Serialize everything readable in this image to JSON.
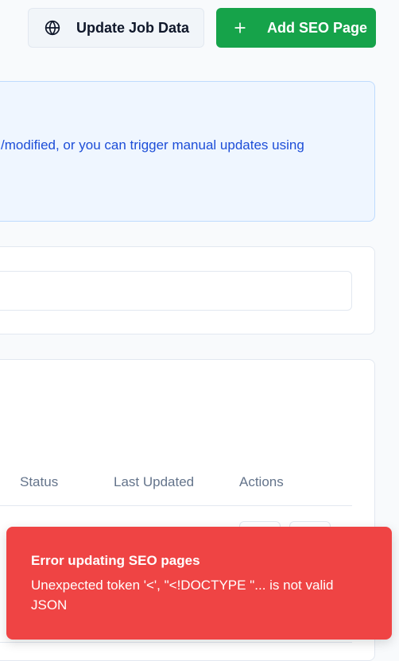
{
  "toolbar": {
    "update_label": "Update Job Data",
    "add_label": "Add SEO Page",
    "update_icon": "globe-icon",
    "add_icon": "plus-icon"
  },
  "info": {
    "text": "/modified, or you can trigger manual updates using"
  },
  "table": {
    "columns": [
      "Status",
      "Last Updated",
      "Actions"
    ]
  },
  "toast": {
    "title": "Error updating SEO pages",
    "message": "Unexpected token '<', \"<!DOCTYPE \"... is not valid JSON"
  },
  "colors": {
    "primary_green": "#16a34a",
    "error_red": "#ef4444",
    "info_bg": "#eff6ff",
    "info_text": "#1d4ed8"
  }
}
